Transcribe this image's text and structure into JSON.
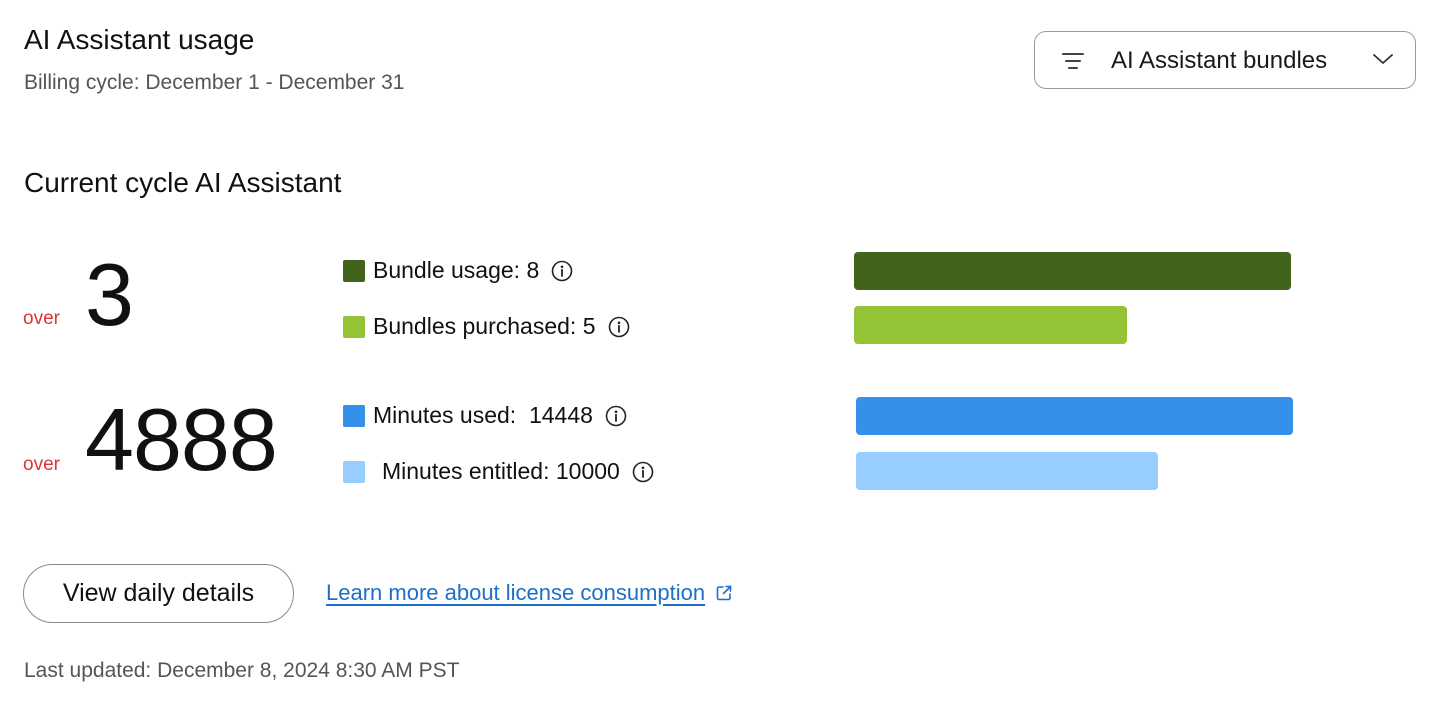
{
  "header": {
    "title": "AI Assistant usage",
    "billing_cycle": "Billing cycle: December 1 - December 31"
  },
  "filter_dropdown": {
    "label": "AI Assistant bundles",
    "icons": [
      "filter-icon",
      "chevron-down-icon"
    ]
  },
  "section": {
    "title": "Current cycle AI Assistant"
  },
  "bundles": {
    "over_label": "over",
    "over_value": "3",
    "usage_label": "Bundle usage: 8",
    "purchased_label": "Bundles purchased: 5",
    "usage_value": 8,
    "purchased_value": 5,
    "usage_color": "#41631c",
    "purchased_color": "#94c337"
  },
  "minutes": {
    "over_label": "over",
    "over_value": "4888",
    "used_label": "Minutes used:  14448",
    "entitled_label": "Minutes entitled: 10000",
    "used_value": 14448,
    "entitled_value": 10000,
    "used_color": "#3490e8",
    "entitled_color": "#98cdff"
  },
  "actions": {
    "view_details": "View daily details",
    "learn_more": "Learn more about license consumption"
  },
  "footer": {
    "last_updated": "Last updated: December 8, 2024 8:30 AM PST"
  },
  "colors": {
    "over_red": "#d93636",
    "link_blue": "#1d6fc9"
  }
}
